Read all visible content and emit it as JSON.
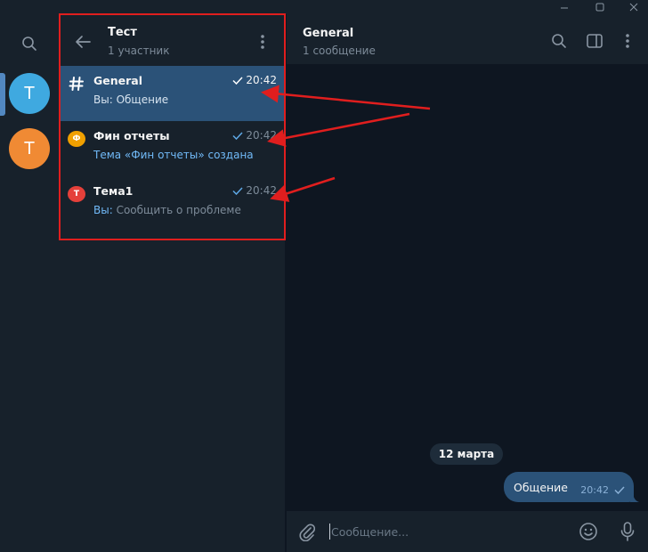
{
  "window": {
    "controls": [
      "minimize-icon",
      "maximize-icon",
      "close-icon"
    ]
  },
  "folders": {
    "search_icon": "search-icon",
    "chats": [
      {
        "letter": "Т",
        "color": "#3fa9e0",
        "active": true
      },
      {
        "letter": "Т",
        "color": "#f08a34",
        "active": false
      }
    ]
  },
  "topics": {
    "title": "Тест",
    "subtitle": "1 участник",
    "items": [
      {
        "name": "General",
        "time": "20:42",
        "prefix": "Вы: ",
        "preview": "Общение",
        "icon": "hash-icon",
        "active": true
      },
      {
        "name": "Фин отчеты",
        "time": "20:42",
        "prefix": "",
        "preview": "Тема «Фин отчеты» создана",
        "icon_letter": "Ф",
        "icon_color": "#f0a000",
        "active": false
      },
      {
        "name": "Тема1",
        "time": "20:42",
        "prefix": "Вы: ",
        "preview": "Сообщить о проблеме",
        "icon_letter": "Т",
        "icon_color": "#e5403a",
        "active": false
      }
    ]
  },
  "chat": {
    "title": "General",
    "subtitle": "1 сообщение",
    "date": "12 марта",
    "message": {
      "text": "Общение",
      "time": "20:42"
    },
    "composer_placeholder": "Сообщение..."
  },
  "colors": {
    "bg": "#0e1621",
    "panel": "#17212b",
    "accent": "#2b5278",
    "highlight": "#e01e1e"
  }
}
